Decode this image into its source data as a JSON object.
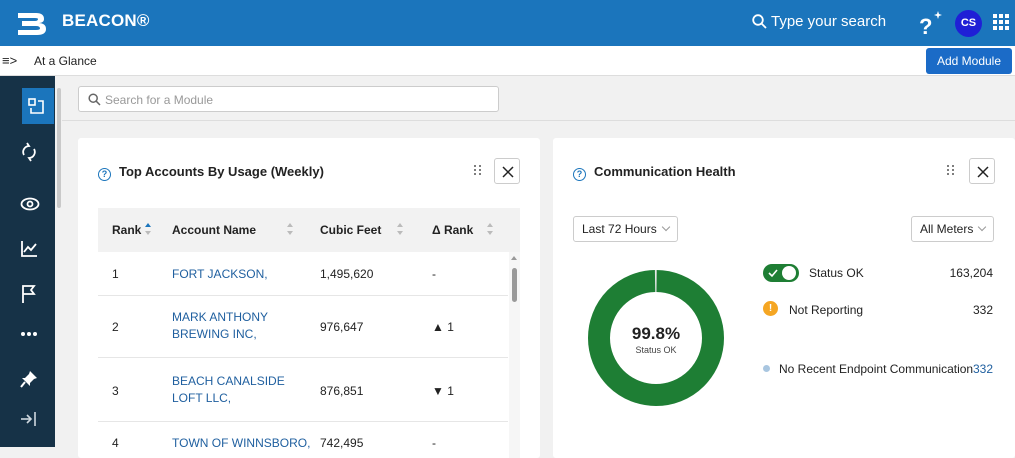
{
  "app": {
    "brand": "BEACON®",
    "search_placeholder": "Type your search",
    "avatar_initials": "CS"
  },
  "breadcrumb": {
    "toggle": "≡>",
    "label": "At a Glance"
  },
  "toolbar": {
    "add_module_label": "Add Module"
  },
  "sidebar": {
    "items": [
      {
        "icon": "dashboard-icon",
        "active": true
      },
      {
        "icon": "sync-icon"
      },
      {
        "icon": "eye-icon"
      },
      {
        "icon": "chart-icon"
      },
      {
        "icon": "flag-icon"
      },
      {
        "icon": "more-icon"
      },
      {
        "icon": "pin-icon"
      },
      {
        "icon": "expand-sidebar-icon"
      }
    ]
  },
  "module_search": {
    "placeholder": "Search for a Module"
  },
  "top_accounts": {
    "title": "Top Accounts By Usage (Weekly)",
    "columns": [
      "Rank",
      "Account Name",
      "Cubic Feet",
      "Δ Rank"
    ],
    "rows": [
      {
        "rank": "1",
        "name": [
          "FORT JACKSON,"
        ],
        "cubic_feet": "1,495,620",
        "delta": "-"
      },
      {
        "rank": "2",
        "name": [
          "MARK ANTHONY",
          "BREWING INC,"
        ],
        "cubic_feet": "976,647",
        "delta": "▲ 1"
      },
      {
        "rank": "3",
        "name": [
          "BEACH CANALSIDE",
          "LOFT LLC,"
        ],
        "cubic_feet": "876,851",
        "delta": "▼ 1"
      },
      {
        "rank": "4",
        "name": [
          "TOWN OF WINNSBORO,"
        ],
        "cubic_feet": "742,495",
        "delta": "-"
      }
    ]
  },
  "comm_health": {
    "title": "Communication Health",
    "period": "Last 72 Hours",
    "meter_filter": "All Meters",
    "donut_value": "99.8%",
    "donut_label": "Status OK",
    "donut_fraction": 0.998,
    "colors": {
      "ok": "#1e7e34",
      "warn": "#f5a623",
      "no_comm": "#a9c6e0"
    },
    "legend": [
      {
        "label": "Status OK",
        "value": "163,204"
      },
      {
        "label": "Not Reporting",
        "value": "332"
      },
      {
        "label": "No Recent Endpoint Communication",
        "value": "332"
      }
    ]
  }
}
